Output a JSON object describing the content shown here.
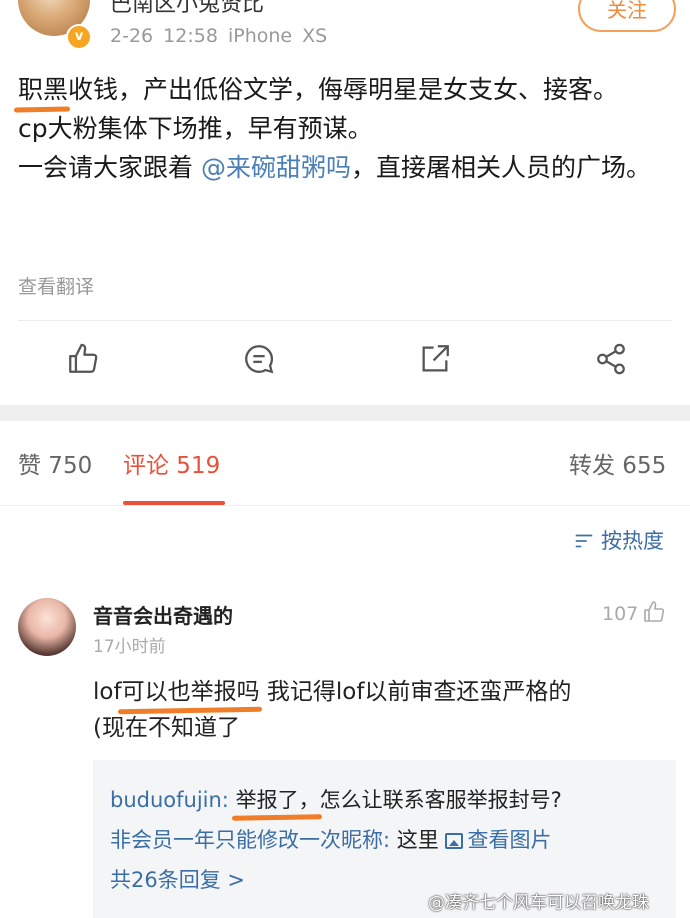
{
  "post": {
    "author": "巴南区小兔贤比",
    "time": "2-26 12:58",
    "device": "iPhone XS",
    "follow_label": "关注",
    "highlight": "职黑",
    "line1_rest": "收钱，产出低俗文学，侮辱明星是女支女、接客。",
    "line2": "cp大粉集体下场推，早有预谋。",
    "line3_pre": "一会请大家跟着",
    "mention": "@来碗甜粥吗",
    "line3_post": "，直接屠相关人员的广场。",
    "translate": "查看翻译"
  },
  "actions": {
    "like_icon": "like-icon",
    "comment_icon": "comment-icon",
    "repost_icon": "repost-icon",
    "share_icon": "share-icon"
  },
  "tabs": {
    "likes": "赞 750",
    "comments": "评论 519",
    "reposts": "转发 655"
  },
  "sort_label": "按热度",
  "comment": {
    "username": "音音会出奇遇的",
    "time": "17小时前",
    "likes": "107",
    "text_pre": "lof",
    "text_hl": "可以也举报吗",
    "text_post": "我记得lof以前审查还蛮严格的",
    "text_line2": "(现在不知道了",
    "replies": [
      {
        "user": "buduofujin:",
        "hl": "举报了，",
        "text": "怎么让联系客服举报封号?"
      },
      {
        "user": "非会员一年只能修改一次昵称:",
        "text": "这里",
        "link": "查看图片"
      }
    ],
    "more_replies": "共26条回复 >"
  },
  "watermark": "@凑齐七个风车可以召唤龙珠",
  "colors": {
    "accent": "#e8513a",
    "link": "#3b6ea5",
    "highlight": "#f07d28",
    "follow": "#f08a3c"
  }
}
